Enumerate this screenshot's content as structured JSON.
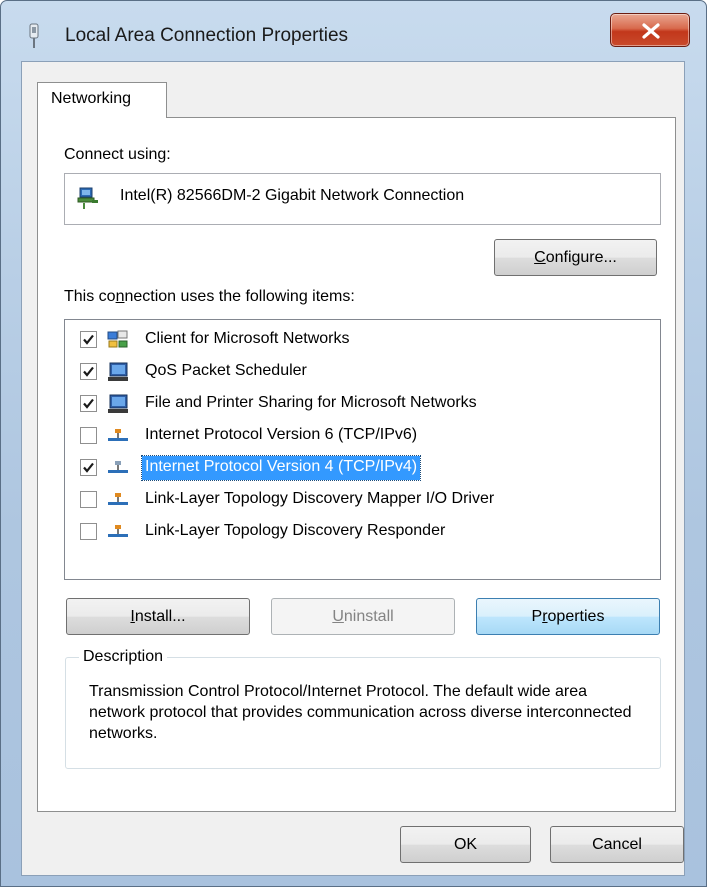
{
  "window": {
    "title": "Local Area Connection Properties"
  },
  "tabs": [
    {
      "label": "Networking"
    }
  ],
  "networking": {
    "connect_using_label": "Connect using:",
    "adapter_name": "Intel(R) 82566DM-2 Gigabit Network Connection",
    "configure_button": {
      "pre": "",
      "accel": "C",
      "post": "onfigure..."
    },
    "items_label": {
      "pre": "This co",
      "accel": "n",
      "post": "nection uses the following items:"
    },
    "items": [
      {
        "label": "Client for Microsoft Networks",
        "checked": true,
        "icon": "network-client-icon",
        "selected": false
      },
      {
        "label": "QoS Packet Scheduler",
        "checked": true,
        "icon": "computer-service-icon",
        "selected": false
      },
      {
        "label": "File and Printer Sharing for Microsoft Networks",
        "checked": true,
        "icon": "computer-service-icon",
        "selected": false
      },
      {
        "label": "Internet Protocol Version 6 (TCP/IPv6)",
        "checked": false,
        "icon": "protocol-icon",
        "selected": false
      },
      {
        "label": "Internet Protocol Version 4 (TCP/IPv4)",
        "checked": true,
        "icon": "protocol-icon",
        "selected": true
      },
      {
        "label": "Link-Layer Topology Discovery Mapper I/O Driver",
        "checked": false,
        "icon": "protocol-icon",
        "selected": false
      },
      {
        "label": "Link-Layer Topology Discovery Responder",
        "checked": false,
        "icon": "protocol-icon",
        "selected": false
      }
    ],
    "install_button": {
      "pre": "",
      "accel": "I",
      "post": "nstall..."
    },
    "uninstall_button": {
      "pre": "",
      "accel": "U",
      "post": "ninstall",
      "enabled": false
    },
    "properties_button": {
      "pre": "P",
      "accel": "r",
      "post": "operties"
    },
    "description": {
      "legend": "Description",
      "text": "Transmission Control Protocol/Internet Protocol. The default wide area network protocol that provides communication across diverse interconnected networks."
    }
  },
  "footer": {
    "ok_label": "OK",
    "cancel_label": "Cancel"
  },
  "colors": {
    "selection": "#3399ff",
    "close_button": "#c94a2c",
    "frame": "#b9cfe6"
  }
}
